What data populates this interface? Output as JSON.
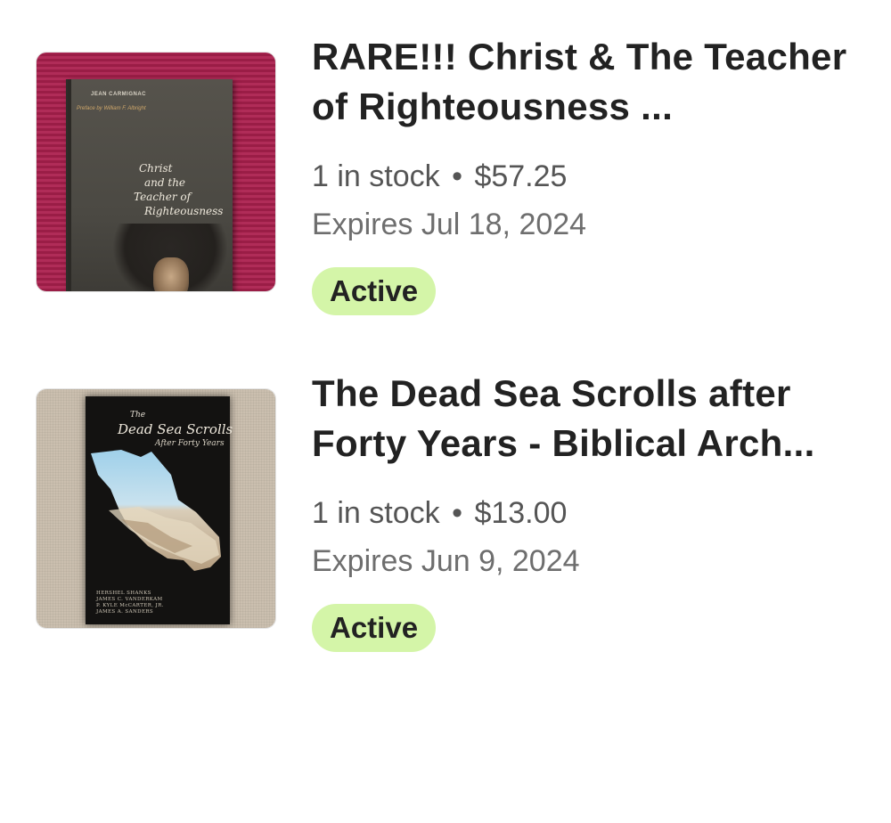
{
  "listings": [
    {
      "title": "RARE!!! Christ & The Teacher of Righteousness ...",
      "stock": "1 in stock",
      "separator": "•",
      "price": "$57.25",
      "expires": "Expires Jul 18, 2024",
      "status": "Active",
      "cover": {
        "author": "JEAN CARMIGNAC",
        "preface": "Preface by William F. Albright",
        "title_lines": [
          "Christ",
          "and the",
          "Teacher of",
          "Righteousness"
        ]
      }
    },
    {
      "title": "The Dead Sea Scrolls after Forty Years - Biblical Arch...",
      "stock": "1 in stock",
      "separator": "•",
      "price": "$13.00",
      "expires": "Expires Jun 9, 2024",
      "status": "Active",
      "cover": {
        "title_small": "The",
        "title_main": "Dead Sea Scrolls",
        "subtitle": "After Forty Years",
        "authors": [
          "HERSHEL SHANKS",
          "JAMES C. VANDERKAM",
          "P. KYLE McCARTER, JR.",
          "JAMES A. SANDERS"
        ]
      }
    }
  ],
  "colors": {
    "badge_bg": "#d4f5a8",
    "title": "#222222",
    "meta": "#555555"
  }
}
